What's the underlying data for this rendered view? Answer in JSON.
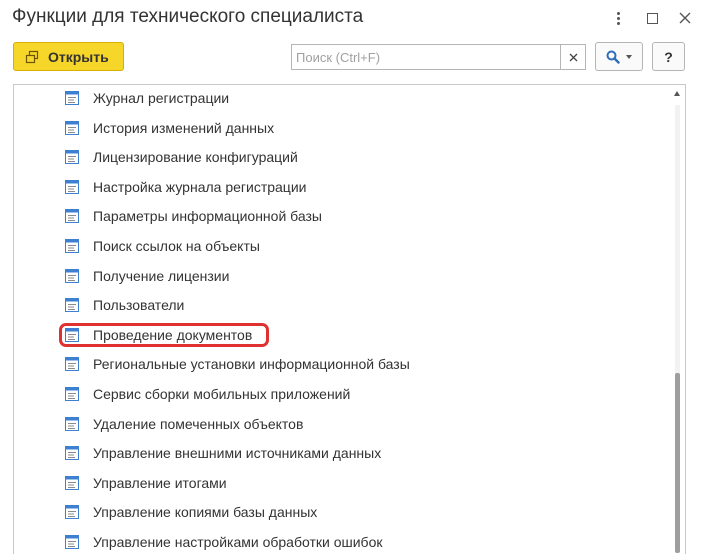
{
  "window": {
    "title": "Функции для технического специалиста"
  },
  "toolbar": {
    "open_label": "Открыть",
    "search_placeholder": "Поиск (Ctrl+F)",
    "search_value": "",
    "clear_label": "×",
    "help_label": "?"
  },
  "list": {
    "items": [
      "Журнал регистрации",
      "История изменений данных",
      "Лицензирование конфигураций",
      "Настройка журнала регистрации",
      "Параметры информационной базы",
      "Поиск ссылок на объекты",
      "Получение лицензии",
      "Пользователи",
      "Проведение документов",
      "Региональные установки информационной базы",
      "Сервис сборки мобильных приложений",
      "Удаление помеченных объектов",
      "Управление внешними источниками данных",
      "Управление итогами",
      "Управление копиями базы данных",
      "Управление настройками обработки ошибок"
    ],
    "highlighted_item": "Проведение документов"
  },
  "colors": {
    "accent_button": "#f7d62a",
    "highlight_border": "#e03131",
    "icon_blue": "#3d7fd1"
  }
}
